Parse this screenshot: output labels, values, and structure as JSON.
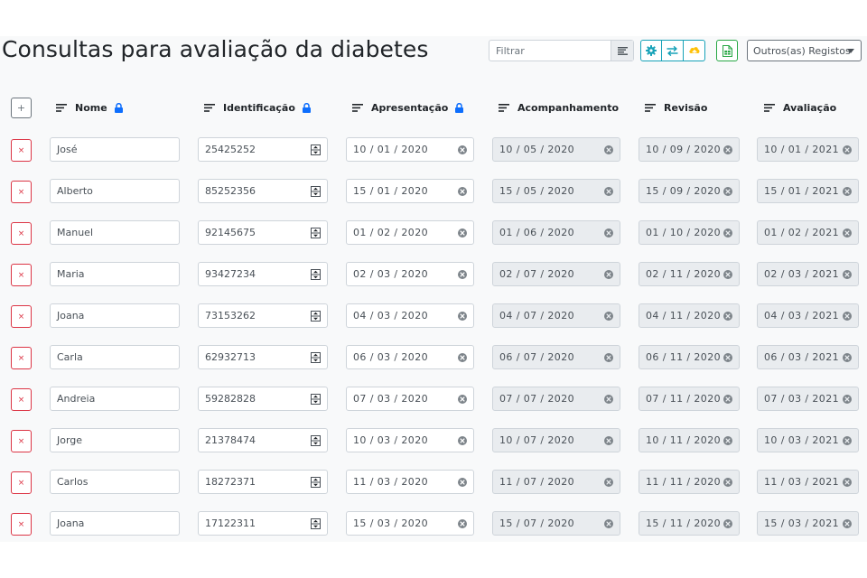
{
  "header": {
    "title": "Consultas para avaliação da diabetes",
    "filter_placeholder": "Filtrar",
    "records_label": "Outros(as) Registos"
  },
  "colors": {
    "info": "#17a2b8",
    "success": "#28a745",
    "warning": "#ffc107",
    "danger": "#dc3545",
    "lock": "#0d6efd"
  },
  "table": {
    "add_label": "+",
    "delete_label": "×",
    "columns": [
      "Nome",
      "Identificação",
      "Apresentação",
      "Acompanhamento",
      "Revisão",
      "Avaliação"
    ],
    "rows": [
      {
        "nome": "José",
        "id": "25425252",
        "apresentacao": "10 / 01 / 2020",
        "acompanhamento": "10 / 05 / 2020",
        "revisao": "10 / 09 / 2020",
        "avaliacao": "10 / 01 / 2021"
      },
      {
        "nome": "Alberto",
        "id": "85252356",
        "apresentacao": "15 / 01 / 2020",
        "acompanhamento": "15 / 05 / 2020",
        "revisao": "15 / 09 / 2020",
        "avaliacao": "15 / 01 / 2021"
      },
      {
        "nome": "Manuel",
        "id": "92145675",
        "apresentacao": "01 / 02 / 2020",
        "acompanhamento": "01 / 06 / 2020",
        "revisao": "01 / 10 / 2020",
        "avaliacao": "01 / 02 / 2021"
      },
      {
        "nome": "Maria",
        "id": "93427234",
        "apresentacao": "02 / 03 / 2020",
        "acompanhamento": "02 / 07 / 2020",
        "revisao": "02 / 11 / 2020",
        "avaliacao": "02 / 03 / 2021"
      },
      {
        "nome": "Joana",
        "id": "73153262",
        "apresentacao": "04 / 03 / 2020",
        "acompanhamento": "04 / 07 / 2020",
        "revisao": "04 / 11 / 2020",
        "avaliacao": "04 / 03 / 2021"
      },
      {
        "nome": "Carla",
        "id": "62932713",
        "apresentacao": "06 / 03 / 2020",
        "acompanhamento": "06 / 07 / 2020",
        "revisao": "06 / 11 / 2020",
        "avaliacao": "06 / 03 / 2021"
      },
      {
        "nome": "Andreia",
        "id": "59282828",
        "apresentacao": "07 / 03 / 2020",
        "acompanhamento": "07 / 07 / 2020",
        "revisao": "07 / 11 / 2020",
        "avaliacao": "07 / 03 / 2021"
      },
      {
        "nome": "Jorge",
        "id": "21378474",
        "apresentacao": "10 / 03 / 2020",
        "acompanhamento": "10 / 07 / 2020",
        "revisao": "10 / 11 / 2020",
        "avaliacao": "10 / 03 / 2021"
      },
      {
        "nome": "Carlos",
        "id": "18272371",
        "apresentacao": "11 / 03 / 2020",
        "acompanhamento": "11 / 07 / 2020",
        "revisao": "11 / 11 / 2020",
        "avaliacao": "11 / 03 / 2021"
      },
      {
        "nome": "Joana",
        "id": "17122311",
        "apresentacao": "15 / 03 / 2020",
        "acompanhamento": "15 / 07 / 2020",
        "revisao": "15 / 11 / 2020",
        "avaliacao": "15 / 03 / 2021"
      }
    ]
  },
  "icons": {
    "filter": "filter-lines-icon",
    "settings": "gear-icon",
    "swap": "swap-arrows-icon",
    "upload": "upload-cloud-icon",
    "export": "excel-file-icon",
    "sort": "sort-lines-icon",
    "lock": "lock-icon",
    "clear": "clear-circle-icon",
    "spinner": "number-spinner-icon"
  }
}
